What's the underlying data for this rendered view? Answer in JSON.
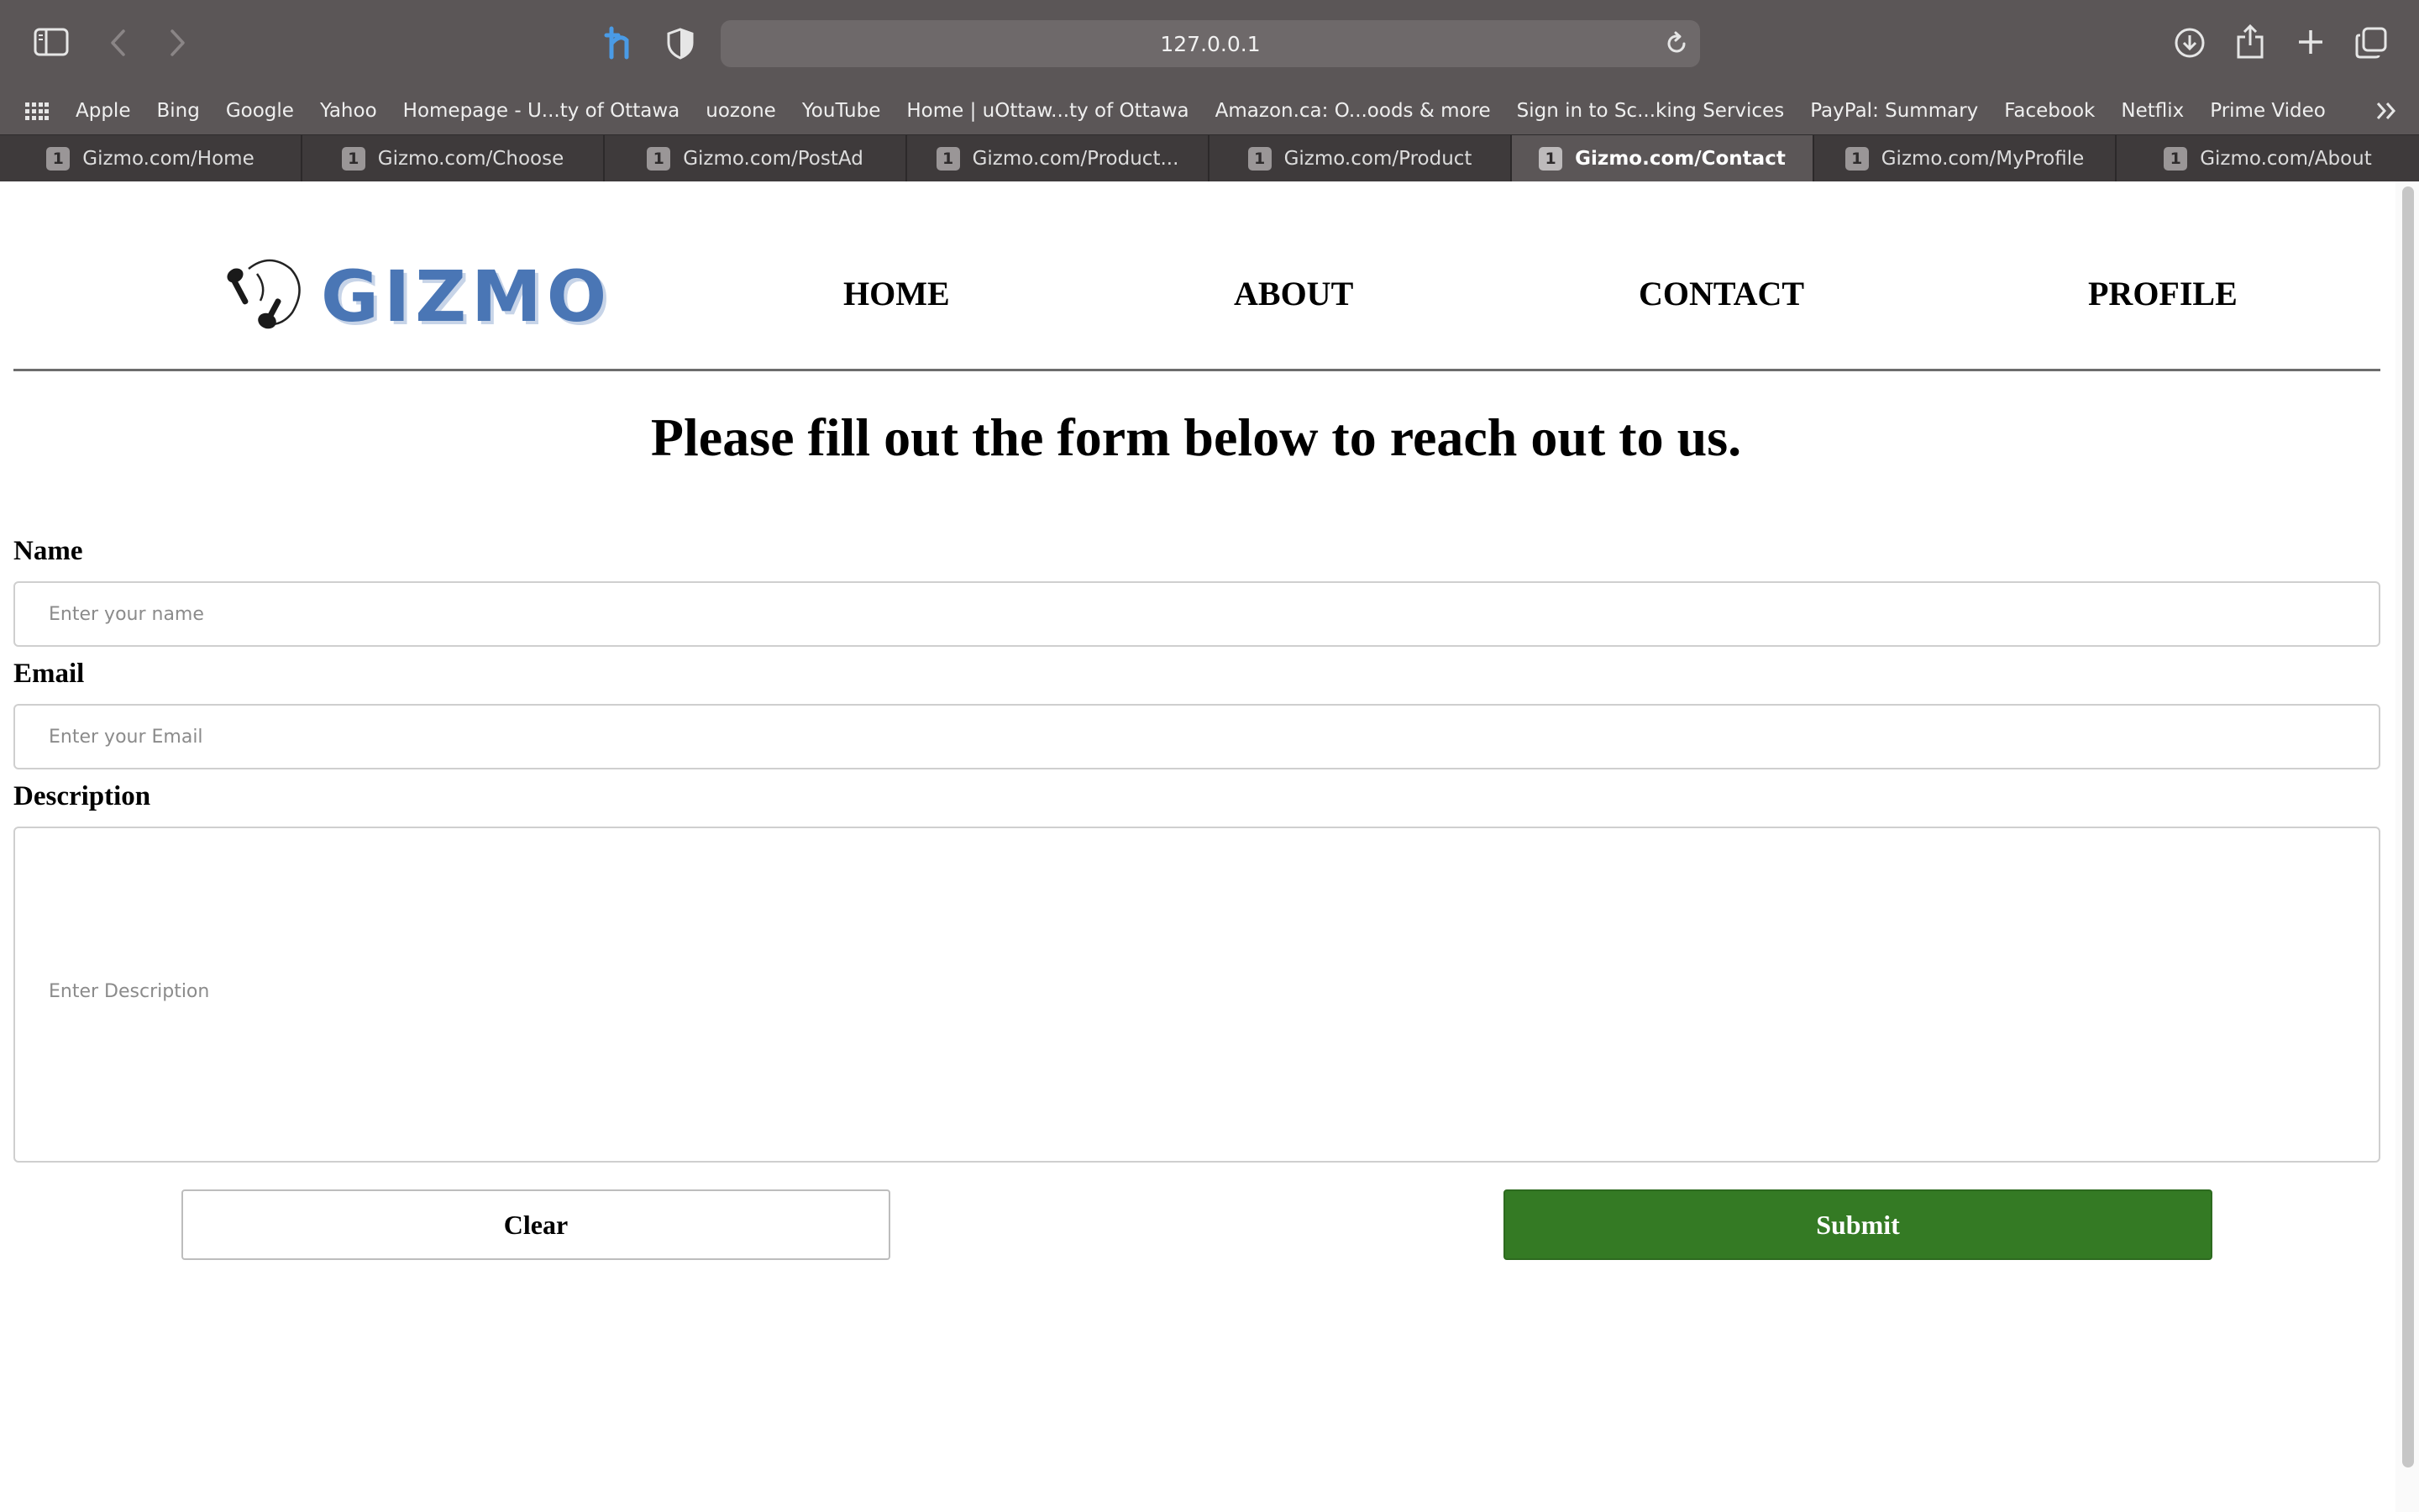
{
  "browser": {
    "url": "127.0.0.1",
    "bookmarks": [
      "Apple",
      "Bing",
      "Google",
      "Yahoo",
      "Homepage - U...ty of Ottawa",
      "uozone",
      "YouTube",
      "Home | uOttaw...ty of Ottawa",
      "Amazon.ca: O...oods & more",
      "Sign in to Sc...king Services",
      "PayPal: Summary",
      "Facebook",
      "Netflix",
      "Prime Video"
    ],
    "tabs": [
      {
        "badge": "1",
        "title": "Gizmo.com/Home"
      },
      {
        "badge": "1",
        "title": "Gizmo.com/Choose"
      },
      {
        "badge": "1",
        "title": "Gizmo.com/PostAd"
      },
      {
        "badge": "1",
        "title": "Gizmo.com/Product..."
      },
      {
        "badge": "1",
        "title": "Gizmo.com/Product"
      },
      {
        "badge": "1",
        "title": "Gizmo.com/Contact"
      },
      {
        "badge": "1",
        "title": "Gizmo.com/MyProfile"
      },
      {
        "badge": "1",
        "title": "Gizmo.com/About"
      }
    ],
    "active_tab": "Gizmo.com/Contact"
  },
  "site": {
    "logo_text": "GIZMO",
    "nav": {
      "home": "HOME",
      "about": "ABOUT",
      "contact": "CONTACT",
      "profile": "PROFILE"
    }
  },
  "contact_form": {
    "heading": "Please fill out the form below to reach out to us.",
    "name_label": "Name",
    "name_placeholder": "Enter your name",
    "email_label": "Email",
    "email_placeholder": "Enter your Email",
    "description_label": "Description",
    "description_placeholder": "Enter Description",
    "clear_label": "Clear",
    "submit_label": "Submit"
  },
  "colors": {
    "logo_blue": "#4a76b5",
    "submit_green": "#347a24",
    "chrome_bg": "#5b5657"
  }
}
